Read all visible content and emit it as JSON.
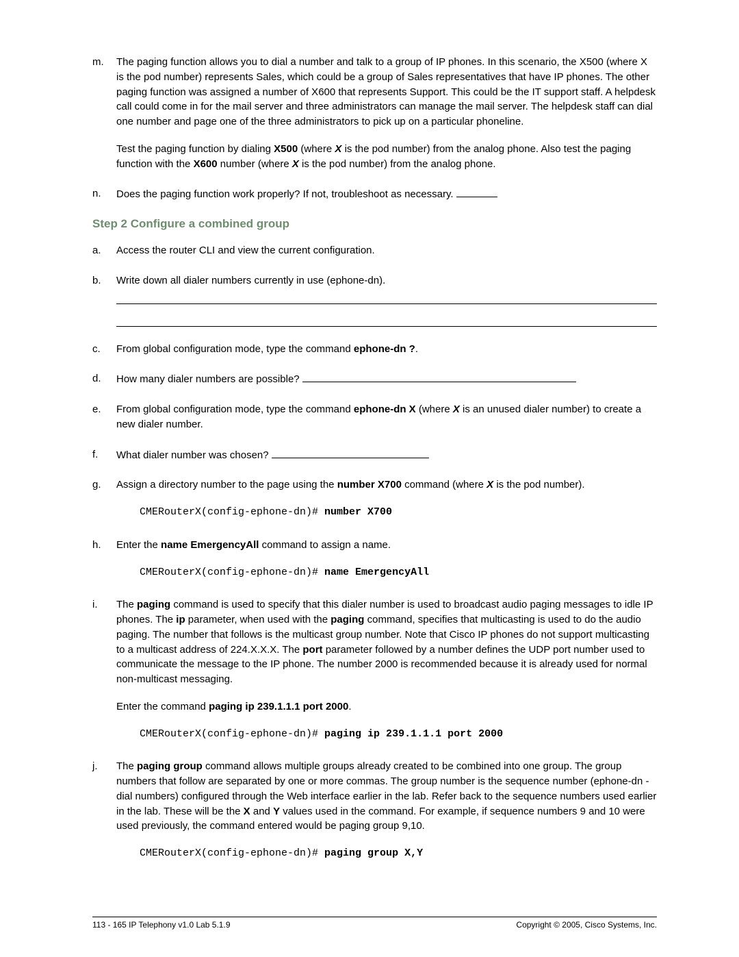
{
  "items1": {
    "m": {
      "marker": "m.",
      "p1a": "The paging function allows you to dial a number and talk to a group of IP phones. In this scenario, the X500 (where X is the pod number) represents Sales, which could be a group of Sales representatives that have IP phones. The other paging function was assigned a number of X600 that represents Support. This could be the IT support staff. A helpdesk call could come in for the mail server and three administrators can manage the mail server. The helpdesk staff can dial one number and page one of the three administrators to pick up on a particular phoneline.",
      "p2_1": "Test the paging function by dialing ",
      "p2_b1": "X500",
      "p2_2": " (where ",
      "p2_i1": "X",
      "p2_3": " is the pod number) from the analog phone. Also test the paging function with the ",
      "p2_b2": "X600",
      "p2_4": " number (where ",
      "p2_i2": "X",
      "p2_5": " is the pod number) from the analog phone."
    },
    "n": {
      "marker": "n.",
      "text": "Does the paging function work properly? If not, troubleshoot as necessary. "
    }
  },
  "step_heading": "Step 2 Configure a combined group",
  "items2": {
    "a": {
      "marker": "a.",
      "text": "Access the router CLI and view the current configuration."
    },
    "b": {
      "marker": "b.",
      "text": "Write down all dialer numbers currently in use (ephone-dn)."
    },
    "c": {
      "marker": "c.",
      "pre": "From global configuration mode, type the command ",
      "bold": "ephone-dn ?",
      "post": "."
    },
    "d": {
      "marker": "d.",
      "text": "How many dialer numbers are possible? "
    },
    "e": {
      "marker": "e.",
      "pre": "From global configuration mode, type the command ",
      "bold": "ephone-dn X",
      "mid": " (where ",
      "ital": "X",
      "post": " is an unused dialer number) to create a new dialer number."
    },
    "f": {
      "marker": "f.",
      "text": "What dialer number was chosen? "
    },
    "g": {
      "marker": "g.",
      "pre": "Assign a directory number to the page using the ",
      "bold": "number X700",
      "mid": " command (where ",
      "ital": "X",
      "post": " is the pod number).",
      "code_prompt": "CMERouterX(config-ephone-dn)# ",
      "code_cmd": "number X700"
    },
    "h": {
      "marker": "h.",
      "pre": "Enter the ",
      "bold": "name EmergencyAll",
      "post": " command to assign a name.",
      "code_prompt": "CMERouterX(config-ephone-dn)# ",
      "code_cmd": "name EmergencyAll"
    },
    "i": {
      "marker": "i.",
      "p1_1": "The ",
      "p1_b1": "paging",
      "p1_2": " command is used to specify that this dialer number is used to broadcast audio paging messages to idle IP phones. The ",
      "p1_b2": "ip",
      "p1_3": " parameter, when used with the ",
      "p1_b3": "paging",
      "p1_4": " command, specifies that multicasting is used to do the audio paging. The number that follows is the multicast group number. Note that Cisco IP phones do not support multicasting to a multicast address of 224.X.X.X. The ",
      "p1_b4": "port",
      "p1_5": " parameter followed by a number defines the UDP port number used to communicate the message to the IP phone. The number 2000 is recommended because it is already used for normal non-multicast messaging.",
      "p2_1": "Enter the command ",
      "p2_b1": "paging ip 239.1.1.1 port 2000",
      "p2_2": ".",
      "code_prompt": "CMERouterX(config-ephone-dn)# ",
      "code_cmd": "paging ip 239.1.1.1 port 2000"
    },
    "j": {
      "marker": "j.",
      "p1_1": "The ",
      "p1_b1": "paging group",
      "p1_2": " command allows multiple groups already created to be combined into one group. The group numbers that follow are separated by one or more commas. The group number is the sequence number (ephone-dn - dial numbers) configured through the Web interface earlier in the lab. Refer back to the sequence numbers used earlier in the lab. These will be the ",
      "p1_b2": "X",
      "p1_3": " and ",
      "p1_b3": "Y",
      "p1_4": " values used in the command. For example, if sequence numbers 9 and 10 were used previously, the command entered would be paging group 9,10.",
      "code_prompt": "CMERouterX(config-ephone-dn)# ",
      "code_cmd": "paging group X,Y"
    }
  },
  "footer": {
    "left": "113 - 165 IP Telephony v1.0   Lab 5.1.9",
    "right": "Copyright © 2005, Cisco Systems, Inc."
  }
}
